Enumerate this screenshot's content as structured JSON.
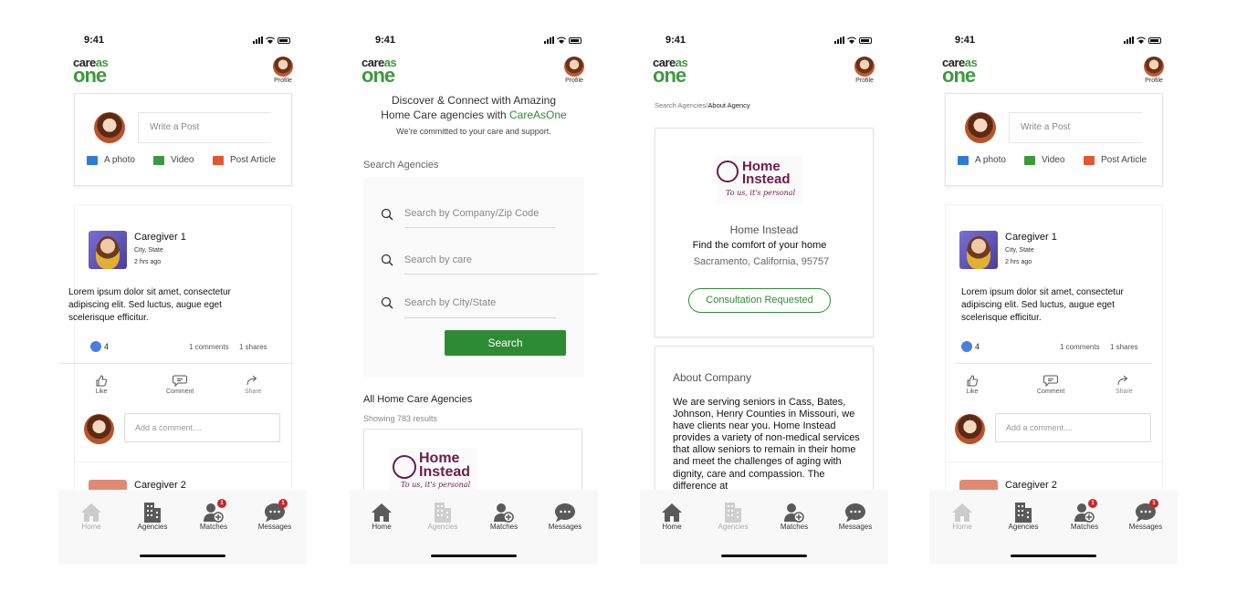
{
  "status": {
    "time": "9:41"
  },
  "brand": {
    "care": "care",
    "as": "as",
    "one": "one"
  },
  "profile": {
    "label": "Profile"
  },
  "composer": {
    "placeholder": "Write a Post",
    "photo": "A photo",
    "video": "Video",
    "article": "Post Article"
  },
  "post1": {
    "name": "Caregiver 1",
    "location": "City, State",
    "time": "2 hrs ago",
    "text": "Lorem ipsum dolor sit amet, consectetur adipiscing elit. Sed luctus, augue eget scelerisque efficitur.",
    "likes": "4",
    "comments": "1 comments",
    "shares": "1 shares",
    "like_label": "Like",
    "comment_label": "Comment",
    "share_label": "Share",
    "add_comment": "Add a comment...."
  },
  "post2": {
    "name": "Caregiver 2"
  },
  "tabs": {
    "home": "Home",
    "agencies": "Agencies",
    "matches": "Matches",
    "messages": "Messages",
    "matches_badge": "1",
    "messages_badge": "1"
  },
  "discover": {
    "line1": "Discover & Connect with Amazing",
    "line2": "Home Care agencies with",
    "brand": "CareAsOne",
    "sub": "We're committed to your care and support.",
    "search_title": "Search Agencies",
    "ph_company": "Search by Company/Zip Code",
    "ph_care": "Search by care",
    "ph_city": "Search by City/State",
    "search_btn": "Search",
    "all_title": "All Home Care Agencies",
    "results": "Showing 783 results"
  },
  "agency": {
    "crumb_link": "Search Agencies",
    "crumb_sep": "/",
    "crumb_current": "About Agency",
    "logo_line1": "Home",
    "logo_line2": "Instead",
    "logo_tag": "To us, it's personal",
    "name": "Home Instead",
    "tagline": "Find the comfort of your home",
    "address": "Sacramento, California, 95757",
    "consult_btn": "Consultation Requested",
    "about_title": "About Company",
    "about_text": "We are serving seniors in Cass, Bates, Johnson, Henry Counties in Missouri, we have clients near you. Home Instead provides a variety of non-medical services that allow seniors to remain in their home and meet the challenges of aging with dignity, care and compassion. The difference at"
  }
}
